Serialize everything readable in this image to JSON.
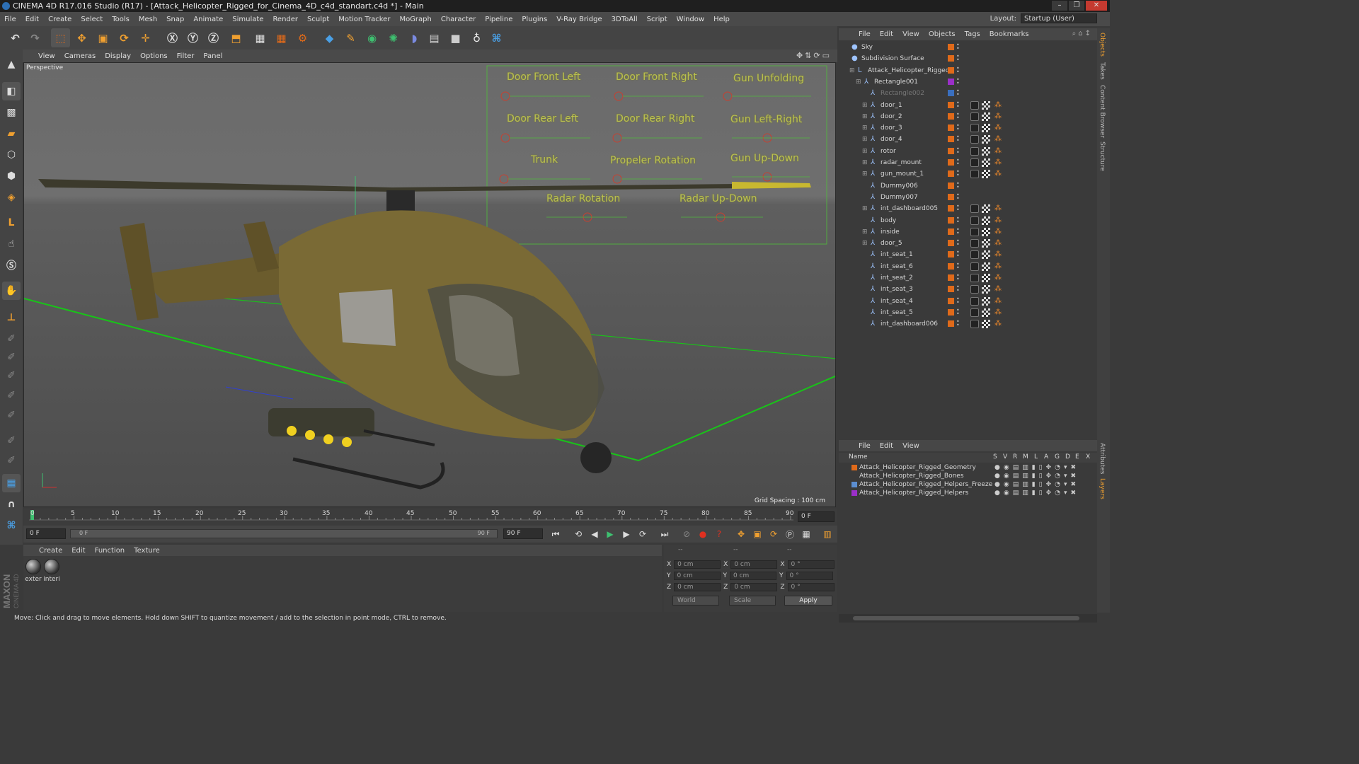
{
  "title": "CINEMA 4D R17.016 Studio (R17) - [Attack_Helicopter_Rigged_for_Cinema_4D_c4d_standart.c4d *] - Main",
  "menubar": [
    "File",
    "Edit",
    "Create",
    "Select",
    "Tools",
    "Mesh",
    "Snap",
    "Animate",
    "Simulate",
    "Render",
    "Sculpt",
    "Motion Tracker",
    "MoGraph",
    "Character",
    "Pipeline",
    "Plugins",
    "V-Ray Bridge",
    "3DToAll",
    "Script",
    "Window",
    "Help"
  ],
  "layout": {
    "label": "Layout:",
    "value": "Startup (User)"
  },
  "viewport_menu": [
    "View",
    "Cameras",
    "Display",
    "Options",
    "Filter",
    "Panel"
  ],
  "viewport": {
    "name": "Perspective",
    "grid_spacing": "Grid Spacing : 100 cm",
    "controls": [
      "Door Front Left",
      "Door Front Right",
      "Gun Unfolding",
      "Door Rear Left",
      "Door Rear Right",
      "Gun Left-Right",
      "Trunk",
      "Propeler Rotation",
      "Gun Up-Down",
      "Radar Rotation",
      "Radar Up-Down"
    ]
  },
  "timeline": {
    "ticks": [
      "0",
      "5",
      "10",
      "15",
      "20",
      "25",
      "30",
      "35",
      "40",
      "45",
      "50",
      "55",
      "60",
      "65",
      "70",
      "75",
      "80",
      "85",
      "90"
    ],
    "current_frame": "0 F",
    "start": "0 F",
    "range_start": "0 F",
    "range_end": "90 F",
    "end": "90 F"
  },
  "material_menu": [
    "Create",
    "Edit",
    "Function",
    "Texture"
  ],
  "materials": [
    "exter",
    "interi"
  ],
  "coords": {
    "header": [
      "--",
      "--",
      "--"
    ],
    "rows": [
      {
        "a": "X",
        "av": "0 cm",
        "b": "X",
        "bv": "0 cm",
        "c": "X",
        "cv": "0 °"
      },
      {
        "a": "Y",
        "av": "0 cm",
        "b": "Y",
        "bv": "0 cm",
        "c": "Y",
        "cv": "0 °"
      },
      {
        "a": "Z",
        "av": "0 cm",
        "b": "Z",
        "bv": "0 cm",
        "c": "Z",
        "cv": "0 °"
      }
    ],
    "world": "World",
    "scale": "Scale",
    "apply": "Apply"
  },
  "status": "Move: Click and drag to move elements. Hold down SHIFT to quantize movement / add to the selection in point mode, CTRL to remove.",
  "object_menu": [
    "File",
    "Edit",
    "View",
    "Objects",
    "Tags",
    "Bookmarks"
  ],
  "objects": [
    {
      "name": "Sky",
      "indent": 0,
      "color": "#e06a1a"
    },
    {
      "name": "Subdivision Surface",
      "indent": 0,
      "color": "#e06a1a"
    },
    {
      "name": "Attack_Helicopter_Rigged",
      "indent": 1,
      "color": "#e06a1a"
    },
    {
      "name": "Rectangle001",
      "indent": 2,
      "color": "#9b2fc9"
    },
    {
      "name": "Rectangle002",
      "indent": 3,
      "color": "#3a6fbf"
    },
    {
      "name": "door_1",
      "indent": 3,
      "color": "#e06a1a"
    },
    {
      "name": "door_2",
      "indent": 3,
      "color": "#e06a1a"
    },
    {
      "name": "door_3",
      "indent": 3,
      "color": "#e06a1a"
    },
    {
      "name": "door_4",
      "indent": 3,
      "color": "#e06a1a"
    },
    {
      "name": "rotor",
      "indent": 3,
      "color": "#e06a1a"
    },
    {
      "name": "radar_mount",
      "indent": 3,
      "color": "#e06a1a"
    },
    {
      "name": "gun_mount_1",
      "indent": 3,
      "color": "#e06a1a"
    },
    {
      "name": "Dummy006",
      "indent": 3,
      "color": "#e06a1a"
    },
    {
      "name": "Dummy007",
      "indent": 3,
      "color": "#e06a1a"
    },
    {
      "name": "int_dashboard005",
      "indent": 3,
      "color": "#e06a1a"
    },
    {
      "name": "body",
      "indent": 3,
      "color": "#e06a1a"
    },
    {
      "name": "inside",
      "indent": 3,
      "color": "#e06a1a"
    },
    {
      "name": "door_5",
      "indent": 3,
      "color": "#e06a1a"
    },
    {
      "name": "int_seat_1",
      "indent": 3,
      "color": "#e06a1a"
    },
    {
      "name": "int_seat_6",
      "indent": 3,
      "color": "#e06a1a"
    },
    {
      "name": "int_seat_2",
      "indent": 3,
      "color": "#e06a1a"
    },
    {
      "name": "int_seat_3",
      "indent": 3,
      "color": "#e06a1a"
    },
    {
      "name": "int_seat_4",
      "indent": 3,
      "color": "#e06a1a"
    },
    {
      "name": "int_seat_5",
      "indent": 3,
      "color": "#e06a1a"
    },
    {
      "name": "int_dashboard006",
      "indent": 3,
      "color": "#e06a1a"
    }
  ],
  "layer_menu": [
    "File",
    "Edit",
    "View"
  ],
  "layer_header": {
    "name": "Name",
    "cols": [
      "S",
      "V",
      "R",
      "M",
      "L",
      "A",
      "G",
      "D",
      "E",
      "X"
    ]
  },
  "layers": [
    {
      "name": "Attack_Helicopter_Rigged_Geometry",
      "color": "#e06a1a"
    },
    {
      "name": "Attack_Helicopter_Rigged_Bones",
      "color": "#3a3a3a"
    },
    {
      "name": "Attack_Helicopter_Rigged_Helpers_Freeze",
      "color": "#5b8ed0"
    },
    {
      "name": "Attack_Helicopter_Rigged_Helpers",
      "color": "#9b2fc9"
    }
  ],
  "right_tabs": [
    "Objects",
    "Takes",
    "Content Browser",
    "Structure",
    "Attributes",
    "Layers"
  ]
}
